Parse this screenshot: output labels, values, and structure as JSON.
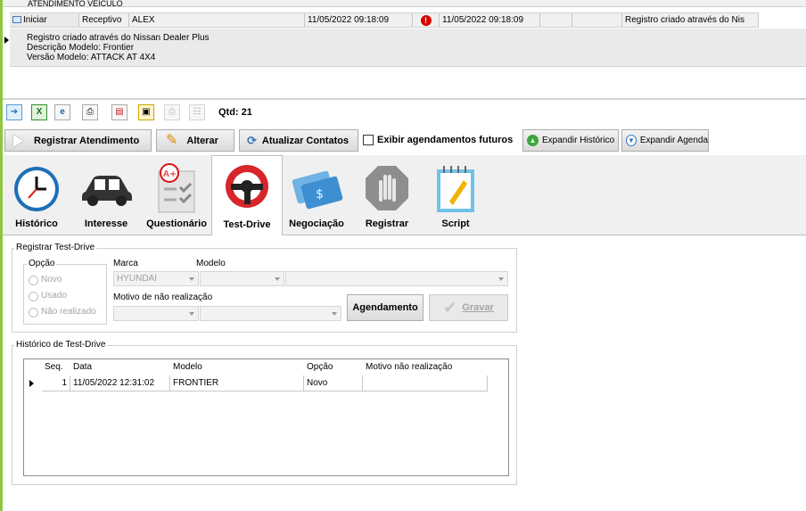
{
  "top_grid": {
    "group_header": "ATENDIMENTO VEICULO",
    "row": {
      "action": "Iniciar",
      "type": "Receptivo",
      "user": "ALEX",
      "date_start": "11/05/2022 09:18:09",
      "date_end": "11/05/2022 09:18:09",
      "note": "Registro criado através do Nis"
    },
    "detail_lines": [
      "Registro criado através do Nissan Dealer Plus",
      "Descrição Modelo: Frontier",
      "Versão Modelo: ATTACK AT 4X4"
    ]
  },
  "toolbar": {
    "qtd_label": "Qtd: 21"
  },
  "actions": {
    "registrar": "Registrar Atendimento",
    "alterar": "Alterar",
    "atualizar": "Atualizar Contatos",
    "exibir": "Exibir agendamentos futuros",
    "expandir_historico": "Expandir Histórico",
    "expandir_agenda": "Expandir Agenda"
  },
  "tabs": [
    {
      "label": "Histórico",
      "icon": "clock-icon"
    },
    {
      "label": "Interesse",
      "icon": "car-icon"
    },
    {
      "label": "Questionário",
      "icon": "checklist-icon"
    },
    {
      "label": "Test-Drive",
      "icon": "steering-wheel-icon"
    },
    {
      "label": "Negociação",
      "icon": "money-card-icon"
    },
    {
      "label": "Registrar",
      "icon": "stop-hand-icon"
    },
    {
      "label": "Script",
      "icon": "notepad-icon"
    }
  ],
  "registrar_test_drive": {
    "title": "Registrar Test-Drive",
    "opcao_label": "Opção",
    "options": [
      "Novo",
      "Usado",
      "Não realizado"
    ],
    "marca_label": "Marca",
    "marca_value": "HYUNDAI",
    "modelo_label": "Modelo",
    "motivo_label": "Motivo de não realização",
    "agendamento_button": "Agendamento",
    "gravar_button": "Gravar"
  },
  "historico_test_drive": {
    "title": "Histórico de Test-Drive",
    "columns": [
      "Seq.",
      "Data",
      "Modelo",
      "Opção",
      "Motivo não realização"
    ],
    "rows": [
      {
        "seq": "1",
        "data": "11/05/2022 12:31:02",
        "modelo": "FRONTIER",
        "opcao": "Novo",
        "motivo": ""
      }
    ]
  },
  "colors": {
    "accent_green": "#8ec63f",
    "alert_red": "#d40000",
    "tab_steering_red": "#d7262a"
  }
}
